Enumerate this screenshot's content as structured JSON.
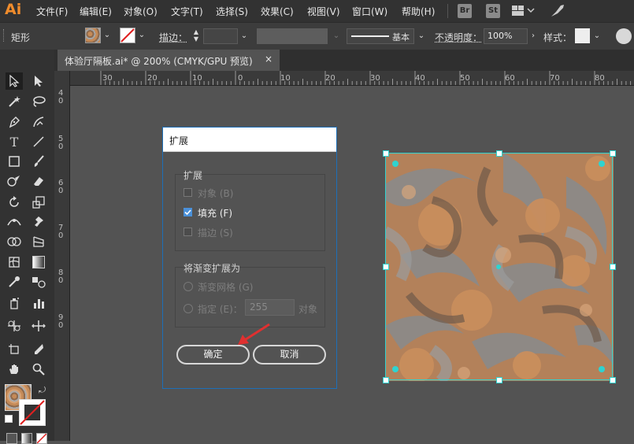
{
  "app": {
    "logo": "Ai"
  },
  "menu": {
    "items": [
      "文件(F)",
      "编辑(E)",
      "对象(O)",
      "文字(T)",
      "选择(S)",
      "效果(C)",
      "视图(V)",
      "窗口(W)",
      "帮助(H)"
    ],
    "br_badge": "Br",
    "st_badge": "St"
  },
  "control": {
    "object_type": "矩形",
    "stroke_label": "描边：",
    "basic_label": "基本",
    "opacity_label": "不透明度：",
    "opacity_value": "100%",
    "style_label": "样式："
  },
  "tab": {
    "title": "体验厅隔板.ai* @ 200% (CMYK/GPU 预览)",
    "close": "×"
  },
  "ruler": {
    "h_labels": [
      "30",
      "20",
      "10",
      "0",
      "10",
      "20",
      "30",
      "40",
      "50",
      "60",
      "70",
      "80"
    ],
    "v_labels": [
      "4",
      "5",
      "6",
      "7",
      "8",
      "9"
    ],
    "v_labels_sub": [
      "0",
      "0",
      "0",
      "0",
      "0",
      "0"
    ]
  },
  "dialog": {
    "title": "扩展",
    "expand_group": "扩展",
    "opt_object": "对象 (B)",
    "opt_fill": "填充 (F)",
    "opt_stroke": "描边 (S)",
    "fill_checked": true,
    "gradient_group": "将渐变扩展为",
    "opt_gradient_mesh": "渐变网格 (G)",
    "opt_specify": "指定 (E)：",
    "specify_value": "255",
    "specify_unit": "对象",
    "ok": "确定",
    "cancel": "取消"
  },
  "colors": {
    "accent_blue": "#1d6fb8",
    "selection_cyan": "#2fd3d0",
    "annotation_red": "#e03030"
  },
  "icons": [
    "selection-tool-icon",
    "direct-selection-tool-icon",
    "magic-wand-icon",
    "lasso-icon",
    "pen-icon",
    "curvature-icon",
    "type-icon",
    "line-icon",
    "rectangle-icon",
    "paintbrush-icon",
    "shaper-icon",
    "eraser-icon",
    "rotate-icon",
    "scale-icon",
    "width-icon",
    "puppet-warp-icon",
    "shape-builder-icon",
    "perspective-icon",
    "mesh-icon",
    "gradient-icon",
    "eyedropper-icon",
    "blend-icon",
    "symbol-sprayer-icon",
    "column-graph-icon",
    "artboard-icon",
    "slice-icon",
    "hand-icon",
    "zoom-icon"
  ]
}
